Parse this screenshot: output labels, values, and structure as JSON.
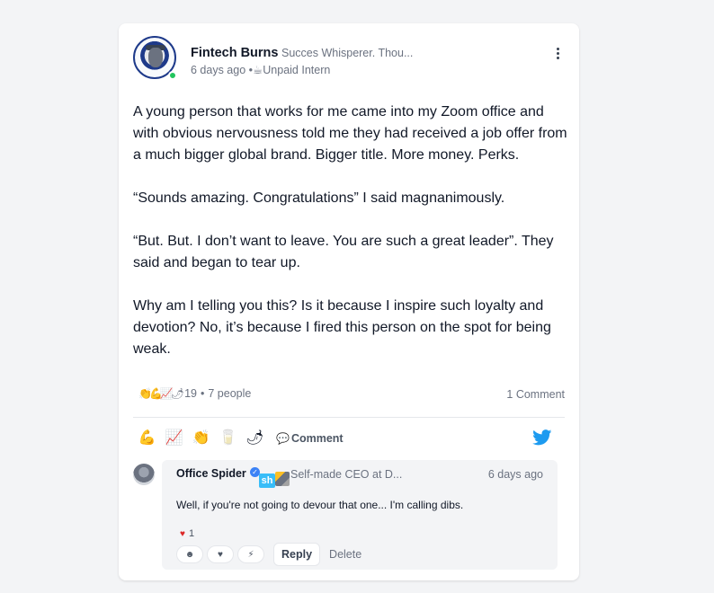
{
  "post": {
    "author": {
      "name": "Fintech Burns",
      "headline": "Succes Whisperer. Thou...",
      "avatar_icon": "author-avatar",
      "online": true
    },
    "time": "6 days ago",
    "separator": "•",
    "role_emoji": "☕",
    "role": "Unpaid Intern",
    "paragraphs": [
      "A young person that works for me came into my Zoom office and with obvious nervousness told me they had received a job offer from a much bigger global brand. Bigger title. More money. Perks.",
      "“Sounds amazing. Congratulations” I said magnanimously.",
      "“But. But. I don’t want to leave. You are such a great leader”. They said and began to tear up.",
      "Why am I telling you this? Is it because I inspire such loyalty and devotion? No, it’s because I fired this person on the spot for being weak."
    ],
    "reactions": {
      "emojis": "👏💪📈🌶",
      "count": "19",
      "separator": "•",
      "people": "7 people"
    },
    "comment_count": "1 Comment",
    "actions": {
      "react_buttons": [
        "💪",
        "📈",
        "👏",
        "🥛",
        "🌶"
      ],
      "comment_icon": "💬",
      "comment_label": "Comment",
      "share_icon": "twitter-icon"
    }
  },
  "comment": {
    "author": "Office Spider",
    "verified_icon": "✓",
    "badge_text": "sh",
    "headline": "Self-made CEO at D...",
    "time": "6 days ago",
    "text": "Well, if you're not going to devour that one... I'm calling dibs.",
    "reaction": {
      "icon": "♥",
      "count": "1"
    },
    "action_pills": [
      "☻",
      "♥",
      "⚡"
    ],
    "reply_label": "Reply",
    "delete_label": "Delete"
  },
  "colors": {
    "background": "#f3f4f6",
    "card": "#ffffff",
    "online": "#22c55e",
    "twitter": "#1d9bf0",
    "verified": "#3b82f6"
  }
}
